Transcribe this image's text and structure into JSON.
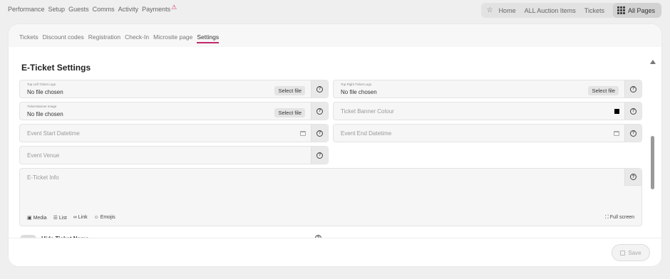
{
  "topnav": {
    "items": [
      "Performance",
      "Setup",
      "Guests",
      "Comms",
      "Activity",
      "Payments"
    ],
    "warning_glyph": "⚠",
    "right_links": [
      "Home",
      "ALL Auction Items",
      "Tickets"
    ],
    "all_pages": "All Pages"
  },
  "subnav": {
    "tabs": [
      "Tickets",
      "Discount codes",
      "Registration",
      "Check-In",
      "Microsite page",
      "Settings"
    ],
    "active": "Settings"
  },
  "page": {
    "title": "E-Ticket Settings"
  },
  "fields": {
    "top_left_logo": {
      "label": "Top Left Ticket Logo",
      "value": "No file chosen",
      "button": "Select file"
    },
    "top_right_logo": {
      "label": "Top Right Ticket Logo",
      "value": "No file chosen",
      "button": "Select file"
    },
    "banner_image": {
      "label": "Ticket Banner Image",
      "value": "No file chosen",
      "button": "Select file"
    },
    "banner_colour": {
      "placeholder": "Ticket Banner Colour",
      "color": "#000000"
    },
    "event_start": {
      "placeholder": "Event Start Datetime"
    },
    "event_end": {
      "placeholder": "Event End Datetime"
    },
    "event_venue": {
      "placeholder": "Event Venue"
    },
    "eticket_info": {
      "placeholder": "E-Ticket Info"
    }
  },
  "editor_toolbar": {
    "media": "Media",
    "list": "List",
    "link": "Link",
    "emojis": "Emojis",
    "fullscreen": "Full screen"
  },
  "hide_ticket_name": {
    "label": "Hide Ticket Name"
  },
  "footer": {
    "save_label": "Save"
  },
  "colors": {
    "accent": "#c0286a",
    "warning": "#d23a5a"
  }
}
